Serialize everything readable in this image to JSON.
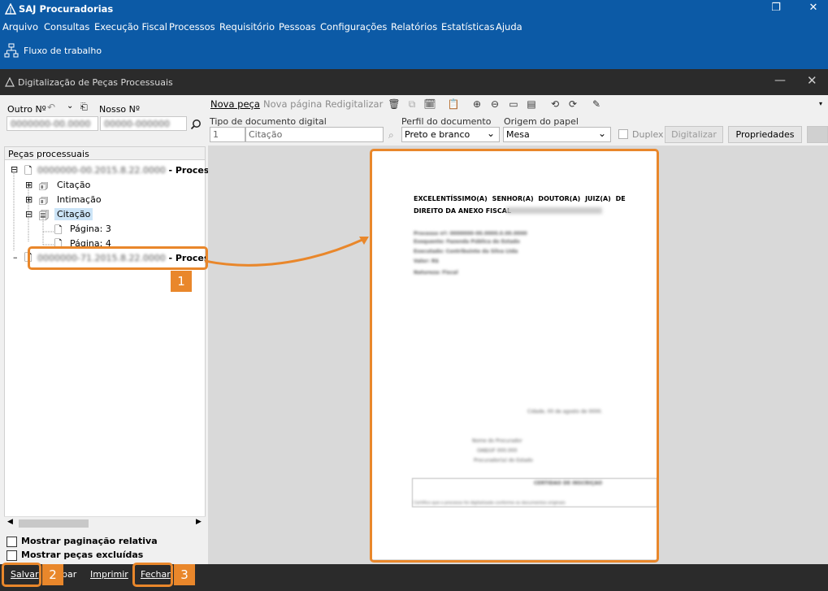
{
  "app": {
    "title": "SAJ Procuradorias",
    "menu": [
      "Arquivo",
      "Consultas",
      "Execução Fiscal",
      "Processos",
      "Requisitório",
      "Pessoas",
      "Configurações",
      "Relatórios",
      "Estatísticas",
      "Ajuda"
    ],
    "workflow_label": "Fluxo de trabalho",
    "window_controls": [
      "restore-icon",
      "close-icon"
    ]
  },
  "dialog": {
    "title": "Digitalização de Peças Processuais"
  },
  "left": {
    "outro_label": "Outro Nº",
    "nosso_label": "Nosso Nº",
    "outro_value": "0000000-00.0000",
    "nosso_value": "00000-000000",
    "tree_header": "Peças processuais",
    "tree": {
      "process1_suffix": "- Processo C",
      "process1_blurred": "0000000-00.2015.8.22.0000",
      "citacao": "Citação",
      "intimacao": "Intimação",
      "citacao_selected": "Citação",
      "pagina3": "Página: 3",
      "pagina4": "Página: 4",
      "process2_suffix": "- Process",
      "process2_blurred": "0000000-71.2015.8.22.0000"
    },
    "chk_paginacao": "Mostrar paginação relativa",
    "chk_excluidas": "Mostrar peças excluídas"
  },
  "right": {
    "nova_peca": "Nova peça",
    "nova_pagina": "Nova página",
    "redigitalizar": "Redigitalizar",
    "tipo_label": "Tipo de documento digital",
    "tipo_code": "1",
    "tipo_value": "Citação",
    "perfil_label": "Perfil do documento",
    "perfil_value": "Preto e branco",
    "origem_label": "Origem do papel",
    "origem_value": "Mesa",
    "duplex_label": "Duplex",
    "digitalizar_label": "Digitalizar",
    "propriedades_label": "Propriedades"
  },
  "document": {
    "heading1": "EXCELENTÍSSIMO(A) SENHOR(A) DOUTOR(A) JUIZ(A) DE",
    "heading2": "DIREITO DA ANEXO FISCAL",
    "blur_lines": [
      "Processo nº: 0000000-00.0000.0.00.0000",
      "Exequente: Fazenda Pública do Estado",
      "Executado: Contribuinte da Silva Ltda",
      "Valor: R$",
      "Natureza: Fiscal"
    ],
    "place_date": "Cidade, 00 de agosto de 0000.",
    "sign1": "Nome do Procurador",
    "sign2": "OAB/UF 000.000",
    "sign3": "Procurador(a) do Estado",
    "box_title": "CERTIDÃO DE INSCRIÇÃO",
    "box_text": "Certifico que o processo foi digitalizado conforme os documentos originais"
  },
  "bottom": {
    "salvar": "Salvar",
    "limpar": "par",
    "imprimir": "Imprimir",
    "fechar": "Fechar"
  },
  "callouts": [
    "1",
    "2",
    "3"
  ],
  "colors": {
    "app_blue": "#0c5aa6",
    "dark_bar": "#2b2b2b",
    "callout_orange": "#e9872b",
    "selection": "#cce4f7"
  }
}
